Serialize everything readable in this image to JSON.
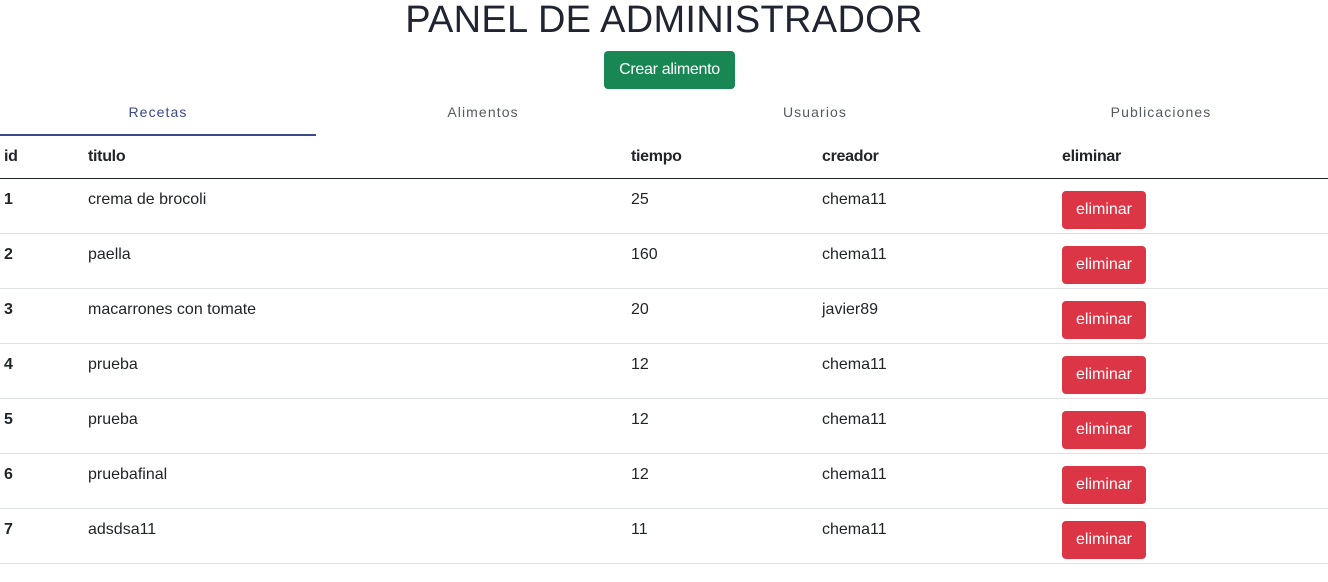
{
  "header": {
    "title": "PANEL DE ADMINISTRADOR",
    "create_button": "Crear alimento"
  },
  "tabs": [
    {
      "label": "Recetas",
      "active": true
    },
    {
      "label": "Alimentos",
      "active": false
    },
    {
      "label": "Usuarios",
      "active": false
    },
    {
      "label": "Publicaciones",
      "active": false
    }
  ],
  "table": {
    "columns": [
      "id",
      "titulo",
      "tiempo",
      "creador",
      "eliminar"
    ],
    "rows": [
      {
        "id": "1",
        "titulo": "crema de brocoli",
        "tiempo": "25",
        "creador": "chema11",
        "action": "eliminar"
      },
      {
        "id": "2",
        "titulo": "paella",
        "tiempo": "160",
        "creador": "chema11",
        "action": "eliminar"
      },
      {
        "id": "3",
        "titulo": "macarrones con tomate",
        "tiempo": "20",
        "creador": "javier89",
        "action": "eliminar"
      },
      {
        "id": "4",
        "titulo": "prueba",
        "tiempo": "12",
        "creador": "chema11",
        "action": "eliminar"
      },
      {
        "id": "5",
        "titulo": "prueba",
        "tiempo": "12",
        "creador": "chema11",
        "action": "eliminar"
      },
      {
        "id": "6",
        "titulo": "pruebafinal",
        "tiempo": "12",
        "creador": "chema11",
        "action": "eliminar"
      },
      {
        "id": "7",
        "titulo": "adsdsa11",
        "tiempo": "11",
        "creador": "chema11",
        "action": "eliminar"
      }
    ]
  },
  "colors": {
    "create_button": "#198754",
    "delete_button": "#dc3545",
    "active_tab": "#3a4a8a"
  }
}
